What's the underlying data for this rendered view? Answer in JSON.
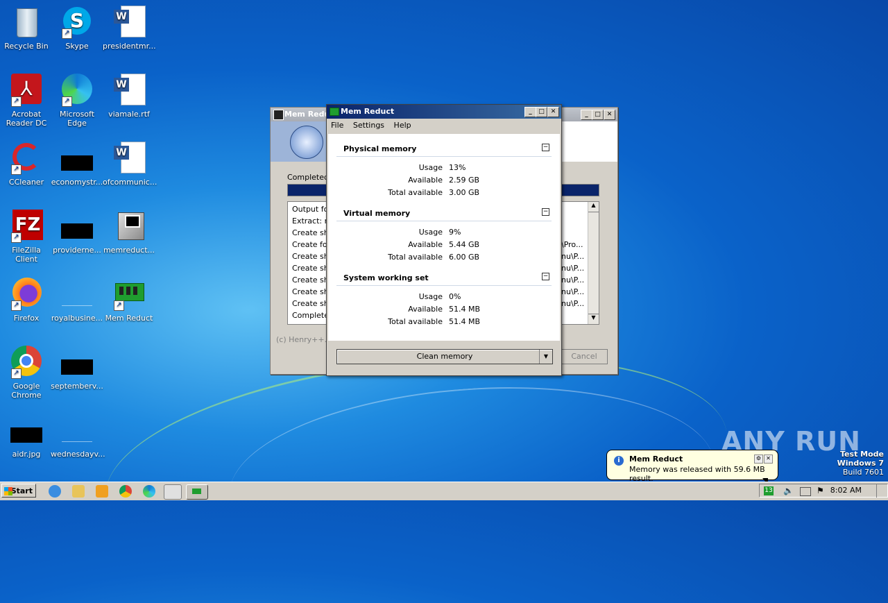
{
  "desktop": {
    "icons": [
      {
        "label": "Recycle Bin"
      },
      {
        "label": "Skype"
      },
      {
        "label": "presidentmr..."
      },
      {
        "label": "Acrobat Reader DC"
      },
      {
        "label": "Microsoft Edge"
      },
      {
        "label": "viamale.rtf"
      },
      {
        "label": "CCleaner"
      },
      {
        "label": "economystr..."
      },
      {
        "label": "ofcommunic..."
      },
      {
        "label": "FileZilla Client"
      },
      {
        "label": "providerne..."
      },
      {
        "label": "memreduct..."
      },
      {
        "label": "Firefox"
      },
      {
        "label": "royalbusine..."
      },
      {
        "label": "Mem Reduct"
      },
      {
        "label": "Google Chrome"
      },
      {
        "label": "septemberv..."
      },
      {
        "label": "aidr.jpg"
      },
      {
        "label": "wednesdayv..."
      }
    ]
  },
  "installer_window": {
    "title": "Mem Redu",
    "status_label": "Completed",
    "log_lines": [
      "Output fo",
      "Extract: m",
      "Create sh",
      "Create fol",
      "Create sh",
      "Create sh",
      "Create sh",
      "Create sh",
      "Create sh",
      "Completed"
    ],
    "log_right": [
      "",
      "",
      "",
      "\\Pro...",
      "nu\\P...",
      "nu\\P...",
      "nu\\P...",
      "nu\\P...",
      "nu\\P...",
      ""
    ],
    "copyright": "(c) Henry++. A",
    "cancel_label": "Cancel"
  },
  "mem_window": {
    "title": "Mem Reduct",
    "menu": [
      "File",
      "Settings",
      "Help"
    ],
    "sections": [
      {
        "title": "Physical memory",
        "rows": [
          {
            "label": "Usage",
            "value": "13%"
          },
          {
            "label": "Available",
            "value": "2.59 GB"
          },
          {
            "label": "Total available",
            "value": "3.00 GB"
          }
        ]
      },
      {
        "title": "Virtual memory",
        "rows": [
          {
            "label": "Usage",
            "value": "9%"
          },
          {
            "label": "Available",
            "value": "5.44 GB"
          },
          {
            "label": "Total available",
            "value": "6.00 GB"
          }
        ]
      },
      {
        "title": "System working set",
        "rows": [
          {
            "label": "Usage",
            "value": "0%"
          },
          {
            "label": "Available",
            "value": "51.4 MB"
          },
          {
            "label": "Total available",
            "value": "51.4 MB"
          }
        ]
      }
    ],
    "clean_button": "Clean memory"
  },
  "notification": {
    "title": "Mem Reduct",
    "message": "Memory was released with 59.6 MB result."
  },
  "taskbar": {
    "start_label": "Start",
    "tray_badge": "13",
    "clock": "8:02 AM"
  },
  "os_info": {
    "line1": "Test Mode",
    "line2": "Windows 7",
    "line3": "Build 7601"
  },
  "watermark": "ANY RUN"
}
